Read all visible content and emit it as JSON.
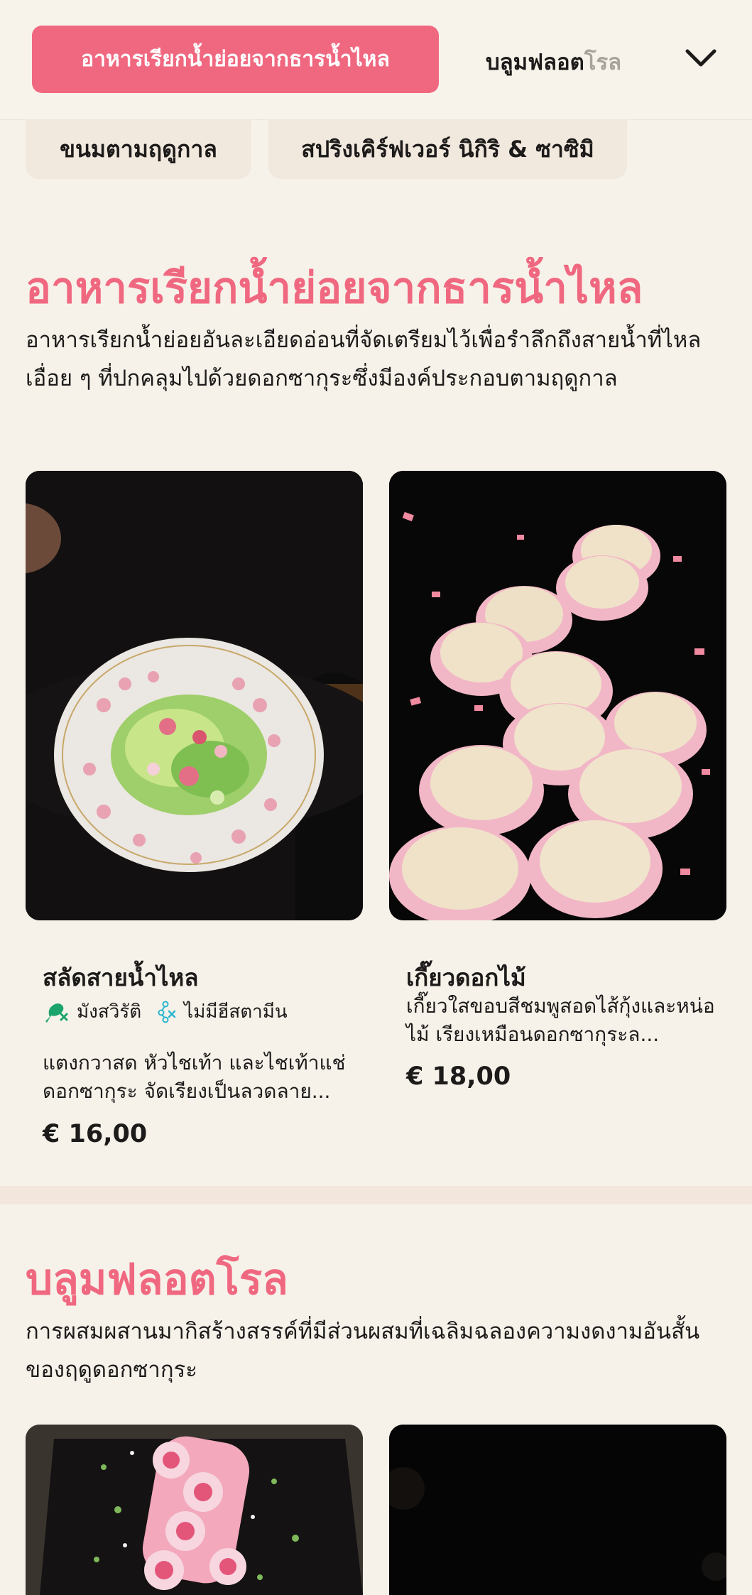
{
  "nav": {
    "active_tab": "อาหารเรียกน้ำย่อยจากธารน้ำไหล",
    "next_tab_bold": "บลูมฟลอต",
    "next_tab_faded": "โรล",
    "chips": [
      "ขนมตามฤดูกาล",
      "สปริงเคิร์ฟเวอร์ นิกิริ & ซาซิมิ"
    ]
  },
  "section1": {
    "title": "อาหารเรียกน้ำย่อยจากธารน้ำไหล",
    "description": "อาหารเรียกน้ำย่อยอันละเอียดอ่อนที่จัดเตรียมไว้เพื่อรำลึกถึงสายน้ำที่ไหลเอื่อย ๆ ที่ปกคลุมไปด้วยดอกซากุระซึ่งมีองค์ประกอบตามฤดูกาล",
    "items": [
      {
        "name": "สลัดสายน้ำไหล",
        "tags": [
          "มังสวิรัติ",
          "ไม่มีฮีสตามีน"
        ],
        "description": "แตงกวาสด หัวไชเท้า และไชเท้าแช่ดอกซากุระ จัดเรียงเป็นลวดลาย...",
        "price": "€ 16,00"
      },
      {
        "name": "เกี๊ยวดอกไม้",
        "description": "เกี๊ยวใสขอบสีชมพูสอดไส้กุ้งและหน่อไม้ เรียงเหมือนดอกซากุระล...",
        "price": "€ 18,00"
      }
    ]
  },
  "section2": {
    "title": "บลูมฟลอตโรล",
    "description": "การผสมผสานมากิสร้างสรรค์ที่มีส่วนผสมที่เฉลิมฉลองความงดงามอันสั้นของฤดูดอกซากุระ"
  },
  "icons": {
    "chevron": "chevron-down-icon",
    "vegetarian": "drumstick-crossed-icon",
    "histamine": "molecule-crossed-icon"
  },
  "colors": {
    "accent": "#f06880",
    "background": "#f6f2ea",
    "tag_green": "#1aa36a",
    "tag_cyan": "#2ab5cf"
  }
}
